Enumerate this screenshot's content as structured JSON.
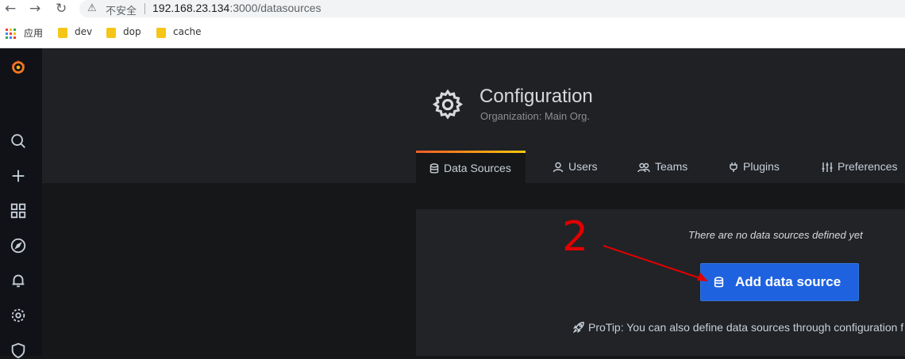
{
  "browser": {
    "back_icon": "arrow-left-icon",
    "forward_icon": "arrow-right-icon",
    "reload_icon": "reload-icon",
    "security_label": "不安全",
    "url_host": "192.168.23.134",
    "url_rest": ":3000/datasources"
  },
  "bookmarks": [
    {
      "label": "应用",
      "icon": "apps-grid-icon"
    },
    {
      "label": "dev",
      "icon": "folder-icon"
    },
    {
      "label": "dop",
      "icon": "folder-icon"
    },
    {
      "label": "cache",
      "icon": "folder-icon"
    }
  ],
  "sidebar": {
    "items": [
      "grafana-logo",
      "search-icon",
      "plus-icon",
      "dashboards-icon",
      "explore-icon",
      "alerting-icon",
      "gear-icon",
      "shield-icon"
    ]
  },
  "page": {
    "title": "Configuration",
    "subtitle": "Organization: Main Org.",
    "tabs": [
      {
        "label": "Data Sources",
        "active": true
      },
      {
        "label": "Users",
        "active": false
      },
      {
        "label": "Teams",
        "active": false
      },
      {
        "label": "Plugins",
        "active": false
      },
      {
        "label": "Preferences",
        "active": false
      }
    ]
  },
  "content": {
    "empty_message": "There are no data sources defined yet",
    "add_button_label": "Add data source",
    "protip": "ProTip: You can also define data sources through configuration f"
  },
  "annotation": {
    "number": "2",
    "color": "#e00000"
  },
  "colors": {
    "accent": "#1f62e0",
    "tab_gradient_start": "#f05a28",
    "tab_gradient_end": "#fbca0a"
  }
}
